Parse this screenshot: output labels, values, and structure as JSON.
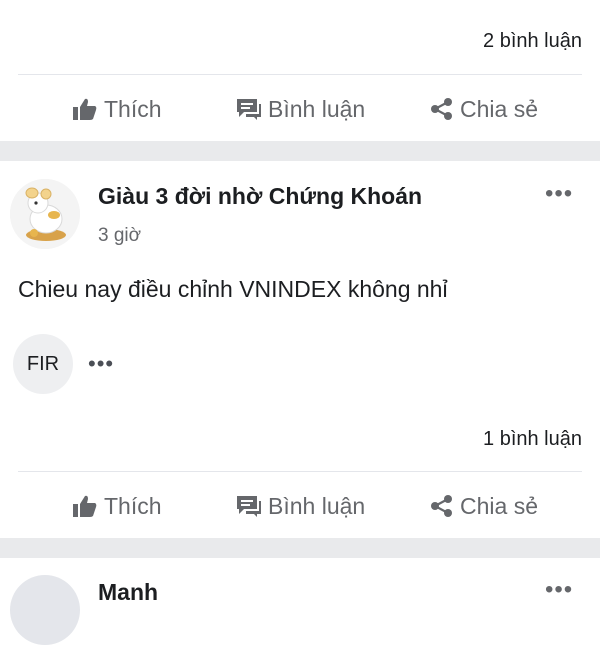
{
  "post1": {
    "comment_count": "2 bình luận",
    "actions": {
      "like": "Thích",
      "comment": "Bình luận",
      "share": "Chia sẻ"
    }
  },
  "post2": {
    "author": "Giàu 3 đời nhờ Chứng Khoán",
    "time": "3 giờ",
    "more": "•••",
    "content": "Chieu nay điều chỉnh VNINDEX không nhỉ",
    "reactor_label": "FIR",
    "reactor_more": "•••",
    "comment_count": "1 bình luận",
    "actions": {
      "like": "Thích",
      "comment": "Bình luận",
      "share": "Chia sẻ"
    }
  },
  "post3": {
    "author": "Manh",
    "more": "•••"
  },
  "colors": {
    "text": "#1c1e21",
    "muted": "#65676b",
    "separator": "#e9eaec",
    "divider": "#e4e6eb"
  },
  "icons": {
    "like": "thumbs-up-icon",
    "comment": "comment-icon",
    "share": "share-icon",
    "avatar": "rat-figurine"
  }
}
